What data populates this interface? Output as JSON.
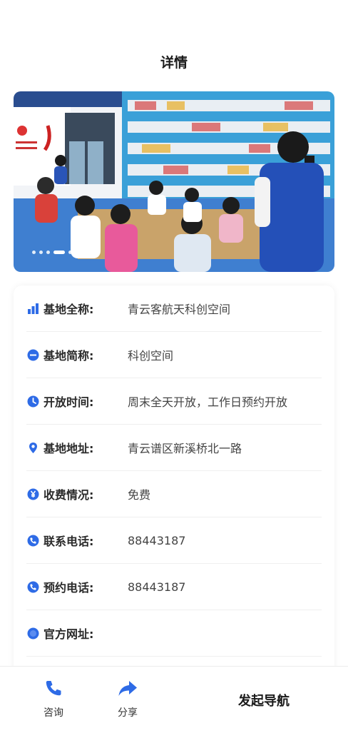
{
  "header": {
    "title": "详情"
  },
  "banner": {
    "slide_count": 6,
    "active_index": 3
  },
  "details": [
    {
      "icon": "chart-bar-icon",
      "label": "基地全称:",
      "value": "青云客航天科创空间"
    },
    {
      "icon": "dash-circle-icon",
      "label": "基地简称:",
      "value": "科创空间"
    },
    {
      "icon": "clock-icon",
      "label": "开放时间:",
      "value": "周末全天开放，工作日预约开放"
    },
    {
      "icon": "location-pin-icon",
      "label": "基地地址:",
      "value": "青云谱区新溪桥北一路"
    },
    {
      "icon": "yuan-icon",
      "label": "收费情况:",
      "value": "免费"
    },
    {
      "icon": "phone-circle-icon",
      "label": "联系电话:",
      "value": "88443187"
    },
    {
      "icon": "phone-circle-icon",
      "label": "预约电话:",
      "value": "88443187"
    },
    {
      "icon": "globe-icon",
      "label": "官方网址:",
      "value": ""
    }
  ],
  "footer": {
    "consult_label": "咨询",
    "share_label": "分享",
    "navigate_label": "发起导航"
  },
  "colors": {
    "accent": "#2e6be6"
  }
}
